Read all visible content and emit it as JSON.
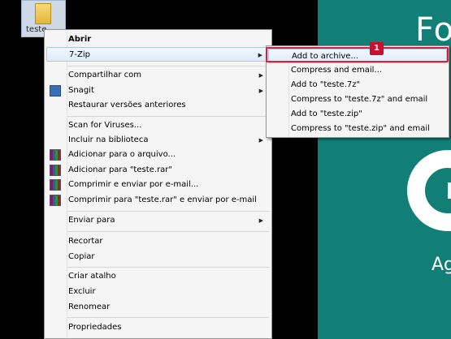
{
  "desktop_icon": {
    "label": "teste"
  },
  "background_app": {
    "partial_title": "Fo",
    "partial_subtitle": "Ag"
  },
  "context_menu": {
    "items": [
      {
        "label": "Abrir",
        "bold": true
      },
      {
        "label": "7-Zip",
        "submenu": true
      },
      {
        "label": "Compartilhar com",
        "submenu": true
      },
      {
        "label": "Snagit",
        "submenu": true
      },
      {
        "label": "Restaurar versões anteriores"
      },
      {
        "label": "Scan for Viruses..."
      },
      {
        "label": "Incluir na biblioteca",
        "submenu": true
      },
      {
        "label": "Adicionar para o arquivo..."
      },
      {
        "label": "Adicionar para \"teste.rar\""
      },
      {
        "label": "Comprimir e enviar por e-mail..."
      },
      {
        "label": "Comprimir para \"teste.rar\" e enviar por e-mail"
      },
      {
        "label": "Enviar para",
        "submenu": true
      },
      {
        "label": "Recortar"
      },
      {
        "label": "Copiar"
      },
      {
        "label": "Criar atalho"
      },
      {
        "label": "Excluir"
      },
      {
        "label": "Renomear"
      },
      {
        "label": "Propriedades"
      }
    ]
  },
  "submenu_7zip": {
    "items": [
      {
        "label": "Add to archive..."
      },
      {
        "label": "Compress and email..."
      },
      {
        "label": "Add to \"teste.7z\""
      },
      {
        "label": "Compress to \"teste.7z\" and email"
      },
      {
        "label": "Add to \"teste.zip\""
      },
      {
        "label": "Compress to \"teste.zip\" and email"
      }
    ]
  },
  "annotation": {
    "step_number": "1",
    "color": "#d8213a"
  },
  "colors": {
    "teal": "#117f76",
    "highlight_border": "#a9c7ea"
  }
}
